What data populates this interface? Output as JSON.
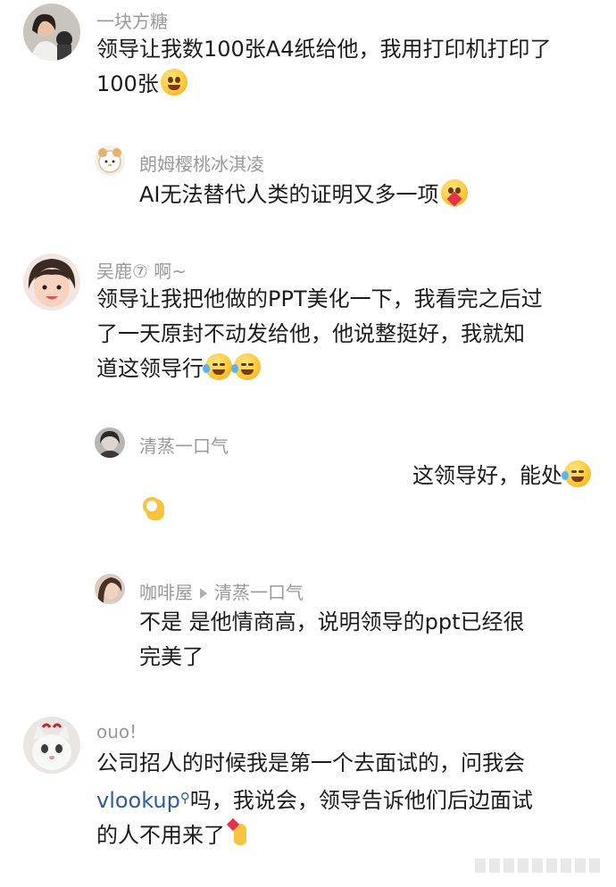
{
  "comments": [
    {
      "user": "一块方糖",
      "lines": [
        "领导让我数100张A4纸给他，我用打印机打印了",
        "100张"
      ]
    },
    {
      "user": "朗姆樱桃冰淇凌",
      "lines": [
        "AI无法替代人类的证明又多一项"
      ]
    },
    {
      "user": "吴鹿⑦ 啊~",
      "lines": [
        "领导让我把他做的PPT美化一下，我看完之后过",
        "了一天原封不动发给他，他说整挺好，我就知",
        "道这领导行"
      ]
    },
    {
      "user": "清蒸一口气",
      "lines": [
        "这领导好，能处"
      ]
    },
    {
      "user": "咖啡屋",
      "reply_to": "清蒸一口气",
      "lines": [
        "不是  是他情商高，说明领导的ppt已经很",
        "完美了"
      ]
    },
    {
      "user": "ouo!",
      "lines": [
        "公司招人的时候我是第一个去面试的，问我会",
        "vlookup",
        "吗，我说会，领导告诉他们后边面试",
        "的人不用来了"
      ]
    }
  ],
  "emojis": [
    "grinning-face-emoji",
    "smiling-face-with-heart-hands-emoji",
    "rolling-laughing-emoji",
    "ok-hand-emoji",
    "crossed-fingers-heart-emoji"
  ]
}
